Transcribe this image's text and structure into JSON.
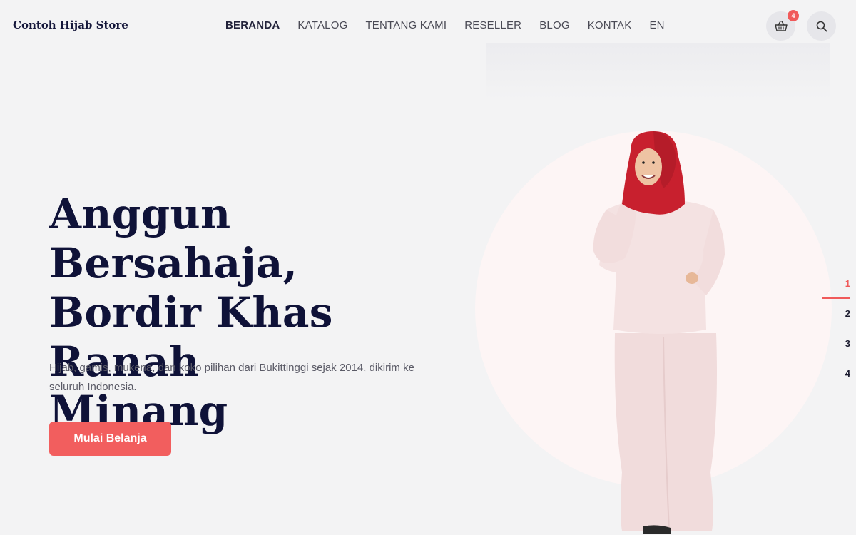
{
  "header": {
    "logo": "Contoh Hijab Store",
    "nav": [
      {
        "label": "BERANDA",
        "active": true
      },
      {
        "label": "KATALOG"
      },
      {
        "label": "TENTANG KAMI"
      },
      {
        "label": "RESELLER"
      },
      {
        "label": "BLOG"
      },
      {
        "label": "KONTAK"
      },
      {
        "label": "EN"
      }
    ],
    "cart_count": "4",
    "icons": {
      "cart": "basket-icon",
      "search": "search-icon"
    }
  },
  "hero": {
    "title_lines": [
      "Anggun Bersahaja,",
      "Bordir Khas Ranah",
      "Minang"
    ],
    "subtitle": "Hijab, gamis, mukena, dan koko pilihan dari Bukittinggi sejak 2014, dikirim ke seluruh Indonesia.",
    "cta_label": "Mulai Belanja"
  },
  "slider": {
    "pages": [
      "1",
      "2",
      "3",
      "4"
    ],
    "active_page": "1"
  },
  "colors": {
    "accent": "#f25e5e",
    "heading": "#0f1238",
    "background": "#f3f3f4",
    "circle": "#fdf5f5",
    "hijab": "#c8202e",
    "dress": "#f2dede"
  }
}
